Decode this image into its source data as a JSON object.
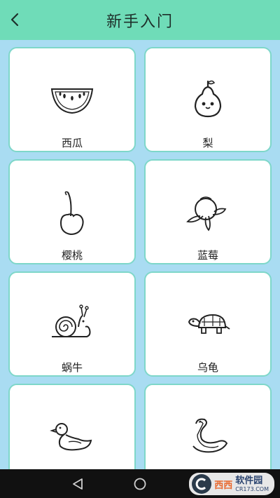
{
  "header": {
    "title": "新手入门",
    "back_icon": "chevron-left-icon"
  },
  "colors": {
    "header_bg": "#6fdcb8",
    "page_bg": "#a9dcf2",
    "card_border": "#7ed7c9"
  },
  "cards": [
    {
      "label": "西瓜",
      "icon": "watermelon-icon"
    },
    {
      "label": "梨",
      "icon": "pear-icon"
    },
    {
      "label": "樱桃",
      "icon": "cherry-icon"
    },
    {
      "label": "蓝莓",
      "icon": "blueberry-icon"
    },
    {
      "label": "蜗牛",
      "icon": "snail-icon"
    },
    {
      "label": "乌龟",
      "icon": "turtle-icon"
    },
    {
      "label": "",
      "icon": "duck-icon"
    },
    {
      "label": "",
      "icon": "snake-icon"
    }
  ],
  "navbar": {
    "back": "nav-back-icon",
    "home": "nav-home-icon",
    "recent": "nav-recent-icon"
  },
  "watermark": {
    "brand": "西西",
    "site": "软件园",
    "url": "CR173.COM"
  }
}
